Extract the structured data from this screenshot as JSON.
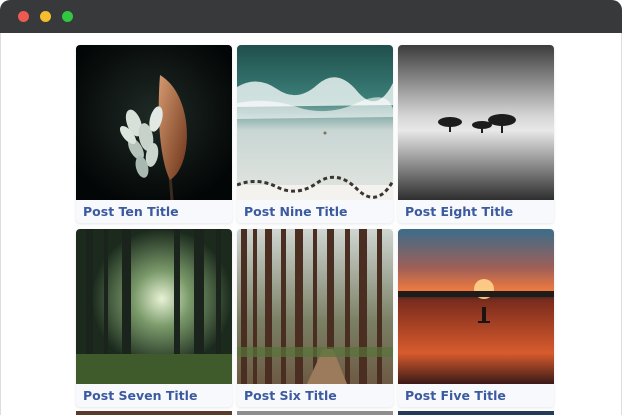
{
  "window": {
    "controls": [
      "close",
      "minimize",
      "maximize"
    ]
  },
  "posts": [
    {
      "title": "Post Ten Title",
      "image": "artichoke-flower-image"
    },
    {
      "title": "Post Nine Title",
      "image": "ocean-beach-aerial-image"
    },
    {
      "title": "Post Eight Title",
      "image": "misty-lake-trees-image"
    },
    {
      "title": "Post Seven Title",
      "image": "sunlit-forest-image"
    },
    {
      "title": "Post Six Title",
      "image": "pine-forest-path-image"
    },
    {
      "title": "Post Five Title",
      "image": "sunset-lake-image"
    }
  ],
  "colors": {
    "titlebar": "#37393b",
    "card_background": "#f8f9fd",
    "title_text": "#3b5a9f"
  }
}
